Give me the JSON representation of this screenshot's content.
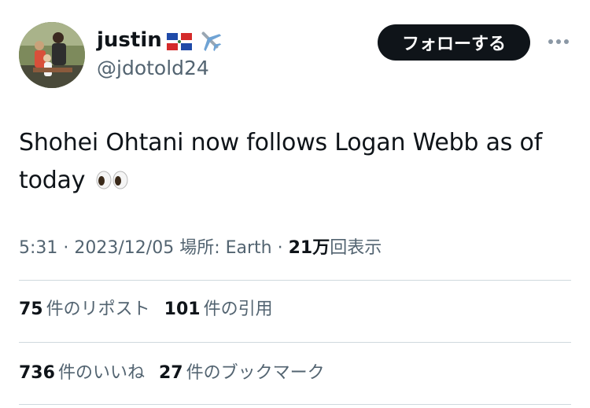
{
  "user": {
    "display_name": "justin",
    "handle": "@jdotold24",
    "flag_icon": "dominican-republic-flag-icon",
    "plane_icon": "airplane-icon"
  },
  "actions": {
    "follow_label": "フォローする",
    "more_icon": "more-horizontal-icon"
  },
  "tweet": {
    "text": "Shohei Ohtani now follows Logan Webb as of today",
    "emoji_icon": "eyes-emoji-icon"
  },
  "meta": {
    "time": "5:31",
    "date": "2023/12/05",
    "location_label": "場所: Earth",
    "views_count": "21万",
    "views_label": "回表示"
  },
  "stats_row1": [
    {
      "count": "75",
      "label": "件のリポスト"
    },
    {
      "count": "101",
      "label": "件の引用"
    }
  ],
  "stats_row2": [
    {
      "count": "736",
      "label": "件のいいね"
    },
    {
      "count": "27",
      "label": "件のブックマーク"
    }
  ],
  "colors": {
    "text_primary": "#0f1419",
    "text_secondary": "#536471",
    "follow_bg": "#0f1419",
    "divider": "#cfd9de"
  }
}
